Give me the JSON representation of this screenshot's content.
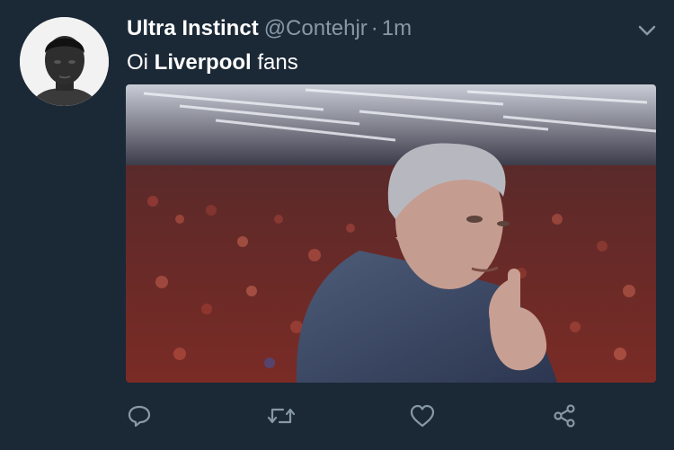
{
  "tweet": {
    "display_name": "Ultra Instinct",
    "handle": "@Contehjr",
    "separator": "·",
    "time": "1m",
    "text_prefix": "Oi ",
    "text_bold": "Liverpool",
    "text_suffix": " fans"
  },
  "actions": {
    "icons": [
      "reply-icon",
      "retweet-icon",
      "like-icon",
      "share-icon"
    ]
  },
  "colors": {
    "background": "#1b2836",
    "secondary_text": "#8899a6",
    "primary_text": "#ffffff"
  }
}
